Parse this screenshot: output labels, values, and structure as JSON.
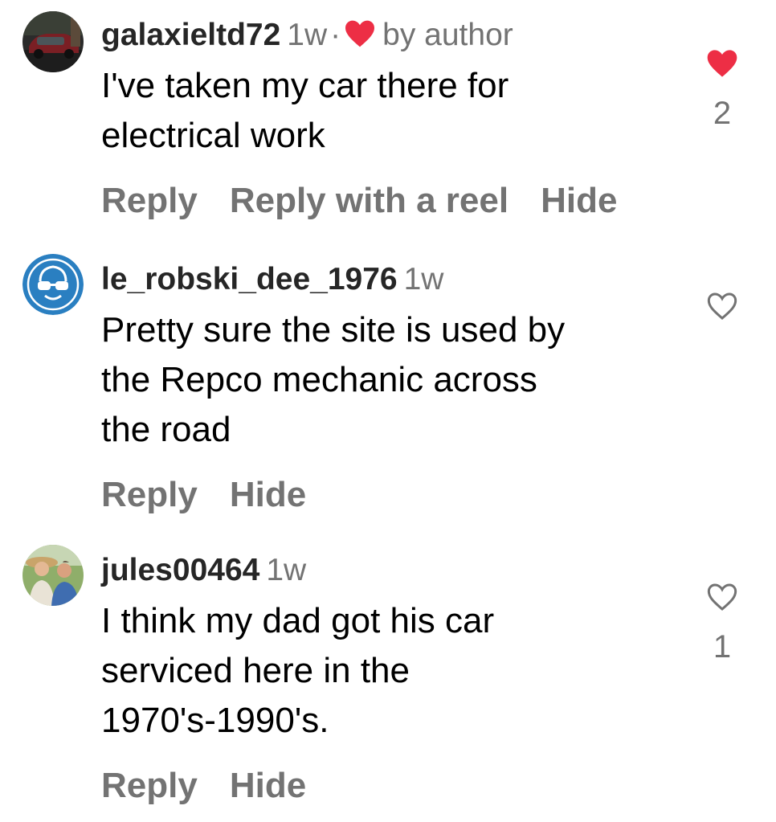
{
  "comments": [
    {
      "username": "galaxieltd72",
      "time": "1w",
      "separator": "·",
      "author_like_label": "by author",
      "text_lines": [
        "I've taken my car there for",
        "electrical work"
      ],
      "actions": [
        "Reply",
        "Reply with a reel",
        "Hide"
      ],
      "like_count": "2",
      "liked": true,
      "avatar": "car-photo"
    },
    {
      "username": "le_robski_dee_1976",
      "time": "1w",
      "text_lines": [
        "Pretty sure the site is used by",
        "the Repco mechanic across",
        "the road"
      ],
      "actions": [
        "Reply",
        "Hide"
      ],
      "like_count": "",
      "liked": false,
      "avatar": "safety-glasses-sign"
    },
    {
      "username": "jules00464",
      "time": "1w",
      "text_lines": [
        "I think my dad got his car",
        "serviced here in the",
        "1970's-1990's."
      ],
      "actions": [
        "Reply",
        "Hide"
      ],
      "like_count": "1",
      "liked": false,
      "avatar": "couple-photo"
    }
  ],
  "colors": {
    "heart_red": "#ed2e45",
    "secondary_text": "#737373",
    "primary_text": "#000000",
    "sign_blue": "#2a7fc1"
  }
}
